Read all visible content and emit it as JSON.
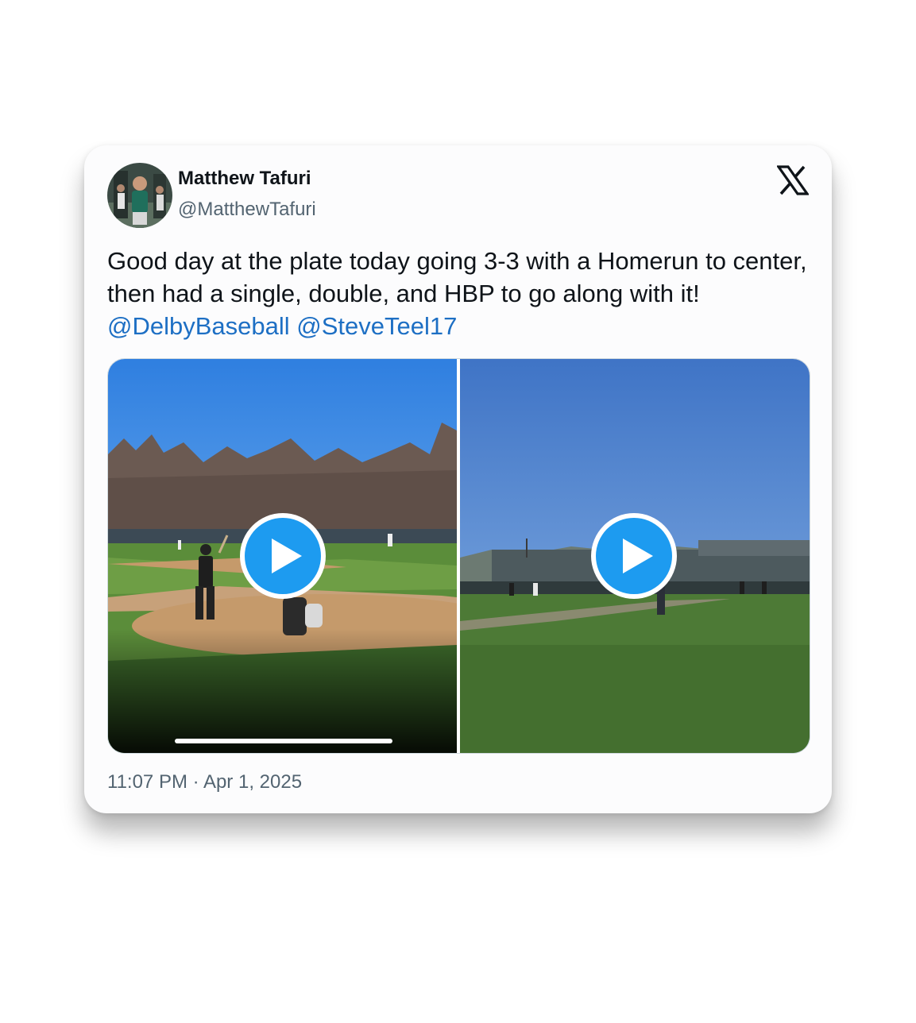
{
  "tweet": {
    "author_name": "Matthew Tafuri",
    "author_handle": "@MatthewTafuri",
    "text_plain": "Good day at the plate today going 3-3 with a Homerun to center, then had a single, double, and HBP to go along with it! ",
    "mentions": [
      "@DelbyBaseball",
      "@SteveTeel17"
    ],
    "mention_separator": " ",
    "timestamp": "11:07 PM · Apr 1, 2025",
    "logo_icon": "x-logo-icon"
  },
  "media": {
    "videos": [
      {
        "icon": "play-icon",
        "scene": "batter-at-home-plate",
        "progress_fraction": 0.62
      },
      {
        "icon": "play-icon",
        "scene": "outfield-view"
      }
    ]
  },
  "colors": {
    "text": "#0f1419",
    "secondary_text": "#536471",
    "link": "#1d6fc4",
    "play_button": "#1d9bf0"
  }
}
